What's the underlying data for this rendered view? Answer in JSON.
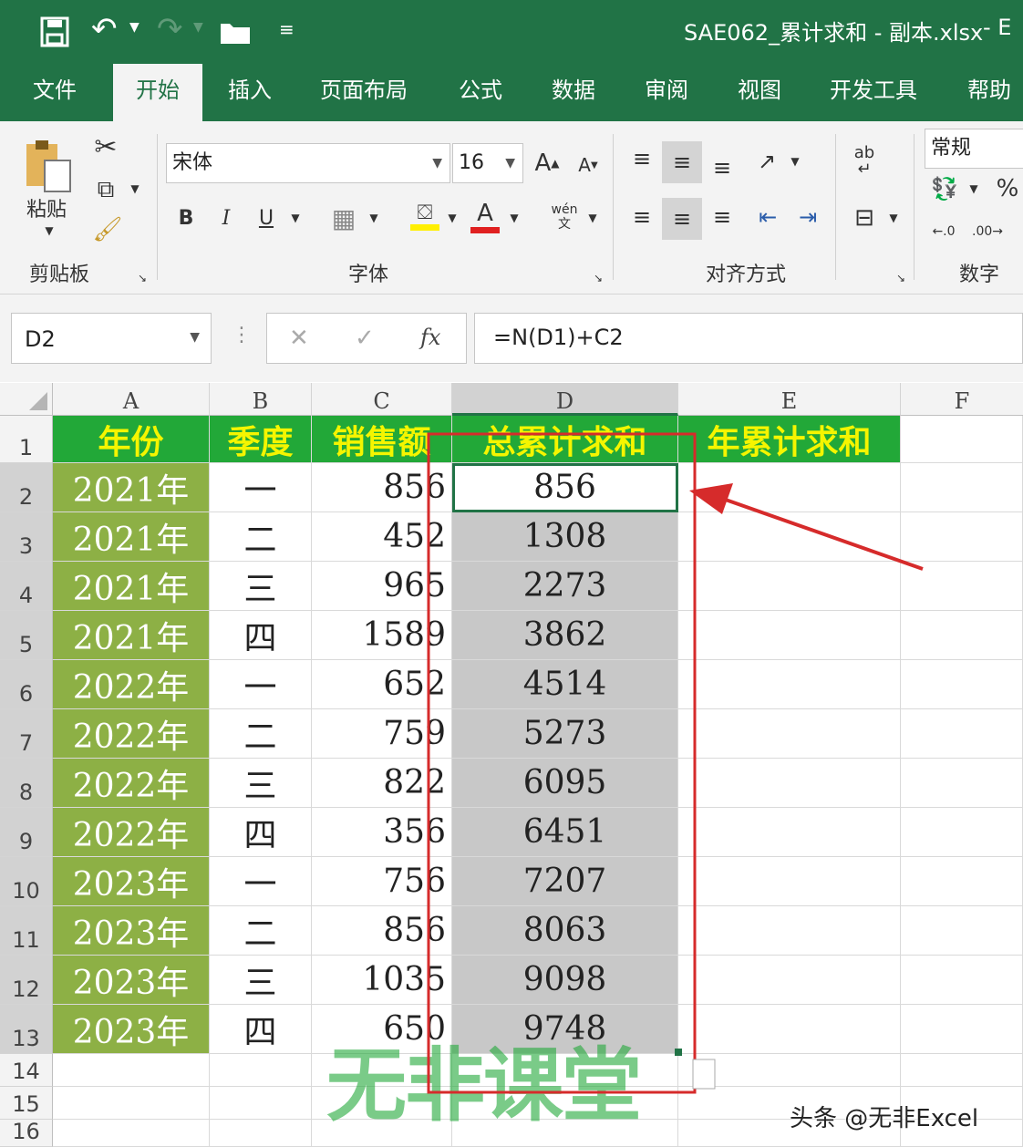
{
  "window": {
    "title": "SAE062_累计求和 - 副本.xlsx",
    "title_suffix": "-  E"
  },
  "tabs": [
    "文件",
    "开始",
    "插入",
    "页面布局",
    "公式",
    "数据",
    "审阅",
    "视图",
    "开发工具",
    "帮助"
  ],
  "active_tab": "开始",
  "ribbon": {
    "clipboard": {
      "paste_label": "粘贴",
      "group_label": "剪贴板"
    },
    "font": {
      "font_name": "宋体",
      "font_size": "16",
      "bold": "B",
      "italic": "I",
      "underline": "U",
      "group_label": "字体",
      "pinyin": "wén",
      "pinyin_char": "文"
    },
    "alignment": {
      "group_label": "对齐方式",
      "wrap": "ab"
    },
    "number": {
      "format": "常规",
      "group_label": "数字",
      "percent": "%"
    }
  },
  "formula_bar": {
    "name_box": "D2",
    "formula": "=N(D1)+C2",
    "fx": "fx"
  },
  "columns": [
    "A",
    "B",
    "C",
    "D",
    "E",
    "F"
  ],
  "rows": [
    "1",
    "2",
    "3",
    "4",
    "5",
    "6",
    "7",
    "8",
    "9",
    "10",
    "11",
    "12",
    "13",
    "14",
    "15",
    "16"
  ],
  "header_row": [
    "年份",
    "季度",
    "销售额",
    "总累计求和",
    "年累计求和"
  ],
  "data_rows": [
    {
      "year": "2021年",
      "quarter": "一",
      "sales": "856",
      "cumulative": "856"
    },
    {
      "year": "2021年",
      "quarter": "二",
      "sales": "452",
      "cumulative": "1308"
    },
    {
      "year": "2021年",
      "quarter": "三",
      "sales": "965",
      "cumulative": "2273"
    },
    {
      "year": "2021年",
      "quarter": "四",
      "sales": "1589",
      "cumulative": "3862"
    },
    {
      "year": "2022年",
      "quarter": "一",
      "sales": "652",
      "cumulative": "4514"
    },
    {
      "year": "2022年",
      "quarter": "二",
      "sales": "759",
      "cumulative": "5273"
    },
    {
      "year": "2022年",
      "quarter": "三",
      "sales": "822",
      "cumulative": "6095"
    },
    {
      "year": "2022年",
      "quarter": "四",
      "sales": "356",
      "cumulative": "6451"
    },
    {
      "year": "2023年",
      "quarter": "一",
      "sales": "756",
      "cumulative": "7207"
    },
    {
      "year": "2023年",
      "quarter": "二",
      "sales": "856",
      "cumulative": "8063"
    },
    {
      "year": "2023年",
      "quarter": "三",
      "sales": "1035",
      "cumulative": "9098"
    },
    {
      "year": "2023年",
      "quarter": "四",
      "sales": "650",
      "cumulative": "9748"
    }
  ],
  "watermark": {
    "logo_text": "无非课堂",
    "credit": "头条 @无非Excel"
  },
  "colors": {
    "excel_green": "#217346",
    "header_fill": "#22a838",
    "header_text": "#f5f500",
    "year_fill": "#8db045",
    "highlight_red": "#d62b2b"
  }
}
